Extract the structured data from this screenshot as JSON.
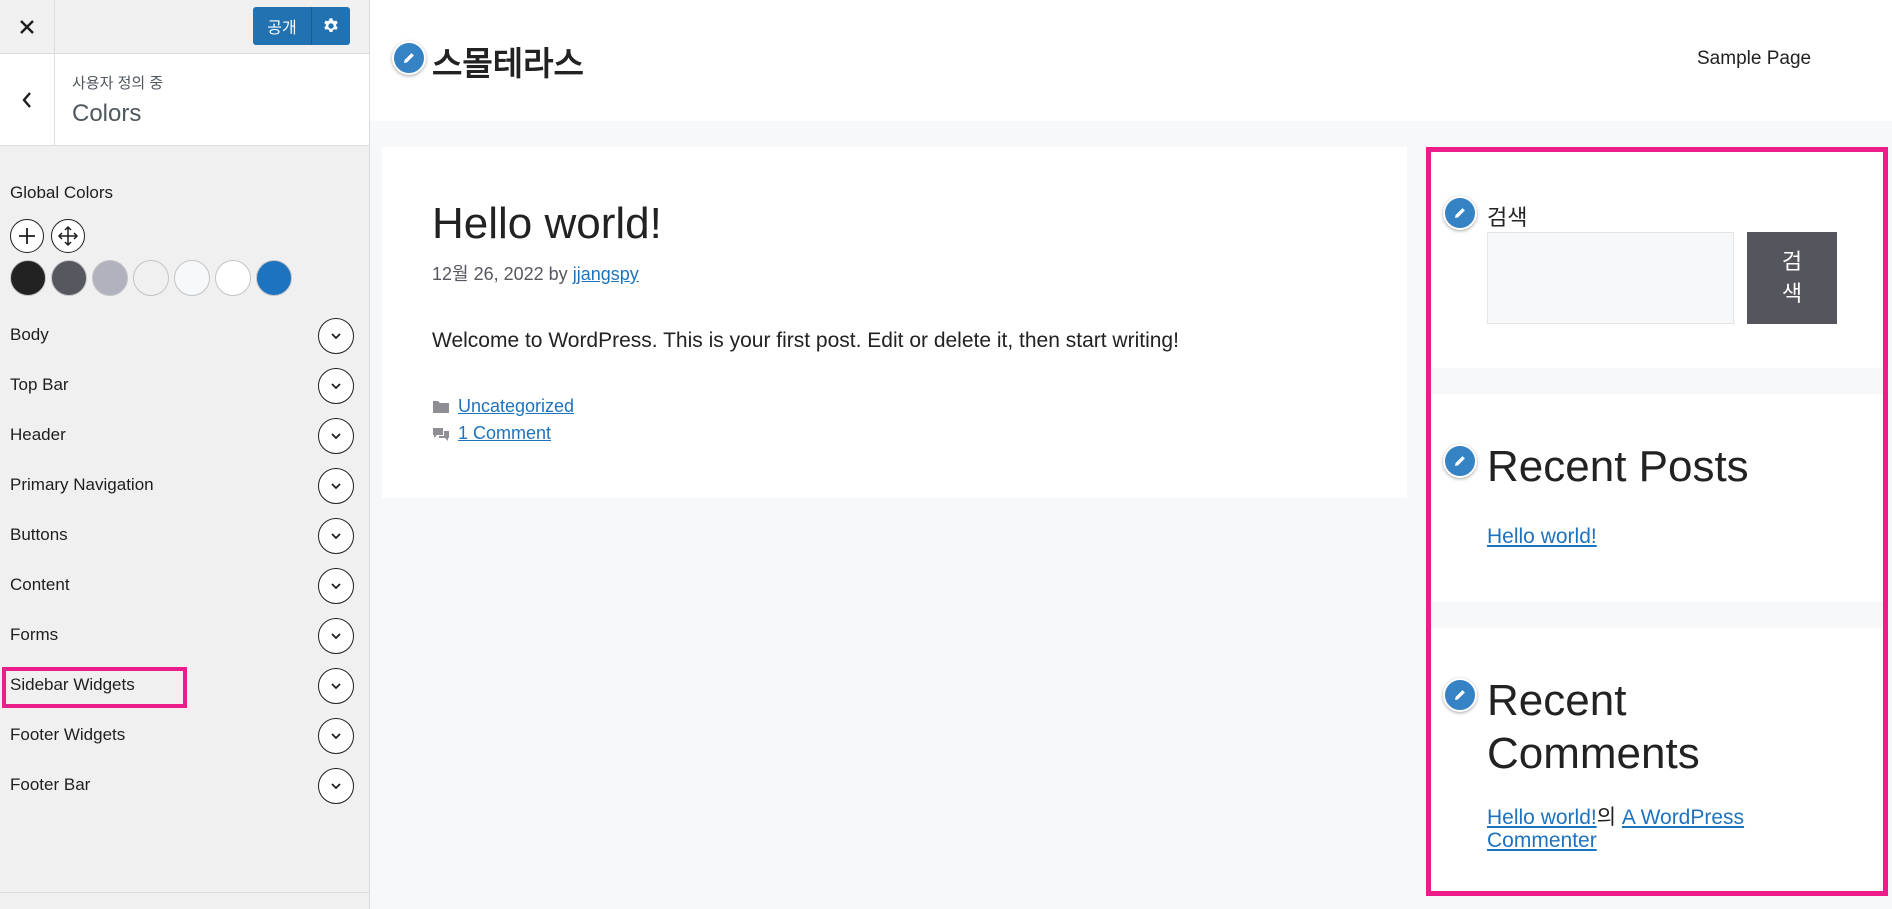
{
  "customizer": {
    "close_icon": "close-icon",
    "publish_label": "공개",
    "settings_icon": "gear-icon",
    "back_icon": "chevron-left-icon",
    "breadcrumb": "사용자 정의 중",
    "section_title": "Colors",
    "global_colors_title": "Global Colors",
    "tools": [
      "plus-icon",
      "move-icon"
    ],
    "swatches": [
      "#222222",
      "#575760",
      "#b2b2be",
      "#f0f0f0",
      "#f7f8f9",
      "#ffffff",
      "#1e73be"
    ],
    "items": [
      {
        "label": "Body"
      },
      {
        "label": "Top Bar"
      },
      {
        "label": "Header"
      },
      {
        "label": "Primary Navigation"
      },
      {
        "label": "Buttons"
      },
      {
        "label": "Content"
      },
      {
        "label": "Forms"
      },
      {
        "label": "Sidebar Widgets"
      },
      {
        "label": "Footer Widgets"
      },
      {
        "label": "Footer Bar"
      }
    ],
    "highlight_color": "#ec1c8a"
  },
  "site": {
    "title": "스몰테라스",
    "nav": {
      "sample_page": "Sample Page"
    },
    "accent": "#1e73be"
  },
  "post": {
    "title": "Hello world!",
    "date": "12월 26, 2022",
    "by": "by",
    "author": "jjangspy",
    "body": "Welcome to WordPress. This is your first post. Edit or delete it, then start writing!",
    "category": "Uncategorized",
    "comments": "1 Comment"
  },
  "widgets": {
    "search": {
      "label": "검색",
      "button_line1": "검",
      "button_line2": "색"
    },
    "recent_posts": {
      "title": "Recent Posts",
      "item": "Hello world!"
    },
    "recent_comments": {
      "title_line1": "Recent",
      "title_line2": "Comments",
      "post_link": "Hello world!",
      "connector": "의",
      "commenter_line1": "A WordPress",
      "commenter_line2": "Commenter"
    }
  }
}
